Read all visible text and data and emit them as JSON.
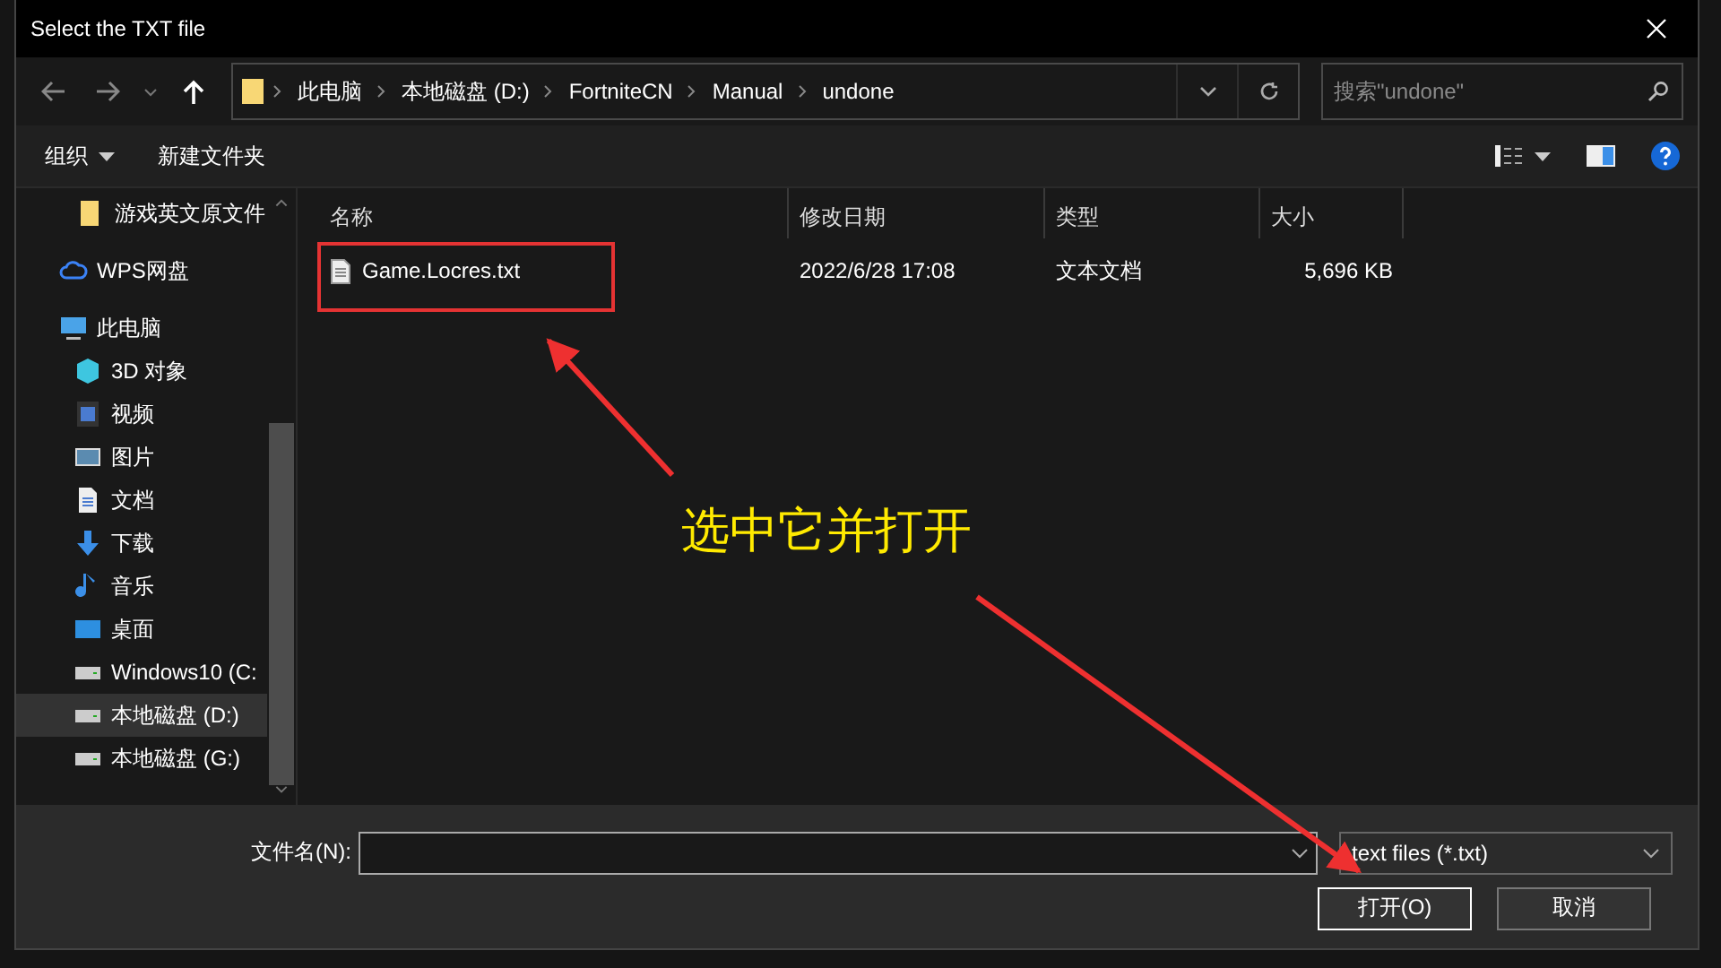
{
  "window": {
    "title": "Select the TXT file"
  },
  "breadcrumb": [
    "此电脑",
    "本地磁盘 (D:)",
    "FortniteCN",
    "Manual",
    "undone"
  ],
  "search": {
    "placeholder": "搜索\"undone\""
  },
  "toolbar": {
    "organize": "组织",
    "new_folder": "新建文件夹"
  },
  "sidebar": {
    "quick_access": [
      {
        "label": "游戏英文原文件",
        "kind": "folder",
        "selected": false
      }
    ],
    "items": [
      {
        "label": "WPS网盘",
        "kind": "cloud",
        "selected": false
      },
      {
        "label": "此电脑",
        "kind": "pc",
        "selected": false,
        "children": [
          {
            "label": "3D 对象",
            "kind": "cube",
            "selected": false
          },
          {
            "label": "视频",
            "kind": "video",
            "selected": false
          },
          {
            "label": "图片",
            "kind": "picture",
            "selected": false
          },
          {
            "label": "文档",
            "kind": "document",
            "selected": false
          },
          {
            "label": "下载",
            "kind": "download",
            "selected": false
          },
          {
            "label": "音乐",
            "kind": "music",
            "selected": false
          },
          {
            "label": "桌面",
            "kind": "desktop",
            "selected": false
          },
          {
            "label": "Windows10 (C:",
            "kind": "drive",
            "selected": false
          },
          {
            "label": "本地磁盘 (D:)",
            "kind": "drive",
            "selected": true
          },
          {
            "label": "本地磁盘 (G:)",
            "kind": "drive",
            "selected": false
          }
        ]
      }
    ]
  },
  "files": {
    "columns": [
      "名称",
      "修改日期",
      "类型",
      "大小"
    ],
    "rows": [
      {
        "name": "Game.Locres.txt",
        "modified": "2022/6/28 17:08",
        "type": "文本文档",
        "size": "5,696 KB",
        "selected": false
      }
    ]
  },
  "bottom": {
    "filename_label": "文件名(N):",
    "filter": "text files (*.txt)",
    "buttons": [
      {
        "label": "打开(O)",
        "default": true
      },
      {
        "label": "取消",
        "default": false
      }
    ]
  },
  "annotation": {
    "callout": "选中它并打开"
  }
}
